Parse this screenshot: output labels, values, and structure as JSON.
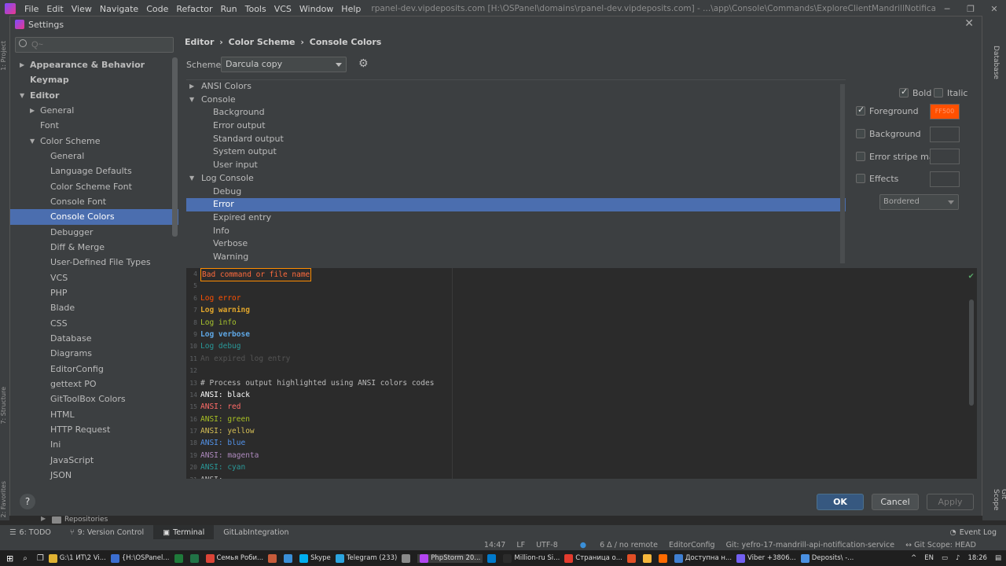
{
  "ide": {
    "menu": [
      "File",
      "Edit",
      "View",
      "Navigate",
      "Code",
      "Refactor",
      "Run",
      "Tools",
      "VCS",
      "Window",
      "Help"
    ],
    "title": "rpanel-dev.vipdeposits.com [H:\\OSPanel\\domains\\rpanel-dev.vipdeposits.com] - ...\\app\\Console\\Commands\\ExploreClientMandrillNotification.php - PhpStorm",
    "left_strip": [
      "1: Project",
      "7: Structure",
      "2: Favorites"
    ],
    "right_strip": [
      "Database",
      "Git Scope"
    ]
  },
  "dialog": {
    "title": "Settings",
    "search_placeholder": "Q~",
    "breadcrumb": [
      "Editor",
      "Color Scheme",
      "Console Colors"
    ],
    "scheme_label": "Scheme:",
    "scheme_value": "Darcula copy",
    "nav": [
      {
        "label": "Appearance & Behavior",
        "level": 0,
        "bold": true,
        "arrow": "▶"
      },
      {
        "label": "Keymap",
        "level": 0,
        "bold": true,
        "arrow": ""
      },
      {
        "label": "Editor",
        "level": 0,
        "bold": true,
        "arrow": "▼"
      },
      {
        "label": "General",
        "level": 1,
        "arrow": "▶"
      },
      {
        "label": "Font",
        "level": 1,
        "arrow": ""
      },
      {
        "label": "Color Scheme",
        "level": 1,
        "arrow": "▼"
      },
      {
        "label": "General",
        "level": 2,
        "arrow": ""
      },
      {
        "label": "Language Defaults",
        "level": 2,
        "arrow": ""
      },
      {
        "label": "Color Scheme Font",
        "level": 2,
        "arrow": ""
      },
      {
        "label": "Console Font",
        "level": 2,
        "arrow": ""
      },
      {
        "label": "Console Colors",
        "level": 2,
        "arrow": "",
        "selected": true
      },
      {
        "label": "Debugger",
        "level": 2,
        "arrow": ""
      },
      {
        "label": "Diff & Merge",
        "level": 2,
        "arrow": ""
      },
      {
        "label": "User-Defined File Types",
        "level": 2,
        "arrow": ""
      },
      {
        "label": "VCS",
        "level": 2,
        "arrow": ""
      },
      {
        "label": "PHP",
        "level": 2,
        "arrow": ""
      },
      {
        "label": "Blade",
        "level": 2,
        "arrow": ""
      },
      {
        "label": "CSS",
        "level": 2,
        "arrow": ""
      },
      {
        "label": "Database",
        "level": 2,
        "arrow": ""
      },
      {
        "label": "Diagrams",
        "level": 2,
        "arrow": ""
      },
      {
        "label": "EditorConfig",
        "level": 2,
        "arrow": ""
      },
      {
        "label": "gettext PO",
        "level": 2,
        "arrow": ""
      },
      {
        "label": "GitToolBox Colors",
        "level": 2,
        "arrow": ""
      },
      {
        "label": "HTML",
        "level": 2,
        "arrow": ""
      },
      {
        "label": "HTTP Request",
        "level": 2,
        "arrow": ""
      },
      {
        "label": "Ini",
        "level": 2,
        "arrow": ""
      },
      {
        "label": "JavaScript",
        "level": 2,
        "arrow": ""
      },
      {
        "label": "JSON",
        "level": 2,
        "arrow": ""
      }
    ],
    "categories": [
      {
        "label": "ANSI Colors",
        "level": 0,
        "arrow": "▶"
      },
      {
        "label": "Console",
        "level": 0,
        "arrow": "▼"
      },
      {
        "label": "Background",
        "level": 1,
        "arrow": ""
      },
      {
        "label": "Error output",
        "level": 1,
        "arrow": ""
      },
      {
        "label": "Standard output",
        "level": 1,
        "arrow": ""
      },
      {
        "label": "System output",
        "level": 1,
        "arrow": ""
      },
      {
        "label": "User input",
        "level": 1,
        "arrow": ""
      },
      {
        "label": "Log Console",
        "level": 0,
        "arrow": "▼"
      },
      {
        "label": "Debug",
        "level": 1,
        "arrow": ""
      },
      {
        "label": "Error",
        "level": 1,
        "arrow": "",
        "selected": true
      },
      {
        "label": "Expired entry",
        "level": 1,
        "arrow": ""
      },
      {
        "label": "Info",
        "level": 1,
        "arrow": ""
      },
      {
        "label": "Verbose",
        "level": 1,
        "arrow": ""
      },
      {
        "label": "Warning",
        "level": 1,
        "arrow": ""
      }
    ],
    "attributes": {
      "bold_label": "Bold",
      "bold_checked": true,
      "italic_label": "Italic",
      "italic_checked": false,
      "foreground_label": "Foreground",
      "foreground_checked": true,
      "foreground_color": "#FF5000",
      "foreground_value": "FF500",
      "background_label": "Background",
      "error_stripe_label": "Error stripe mark",
      "effects_label": "Effects",
      "effect_type": "Bordered"
    },
    "preview": [
      {
        "n": "4",
        "text": "Bad command or file name",
        "color": "#ff6b3d",
        "boxed": true
      },
      {
        "n": "5",
        "text": "",
        "color": "#bbbbbb"
      },
      {
        "n": "6",
        "text": "Log error",
        "color": "#ff5000"
      },
      {
        "n": "7",
        "text": "Log warning",
        "color": "#e0a52b",
        "bold": true
      },
      {
        "n": "8",
        "text": "Log info",
        "color": "#a6c22e"
      },
      {
        "n": "9",
        "text": "Log verbose",
        "color": "#5fa8e6",
        "bold": true
      },
      {
        "n": "10",
        "text": "Log debug",
        "color": "#299999"
      },
      {
        "n": "11",
        "text": "An expired log entry",
        "color": "#555555"
      },
      {
        "n": "12",
        "text": "",
        "color": "#bbbbbb"
      },
      {
        "n": "13",
        "text": "# Process output highlighted using ANSI colors codes",
        "color": "#bbbbbb"
      },
      {
        "n": "14",
        "text": "ANSI: black",
        "color": "#ffffff"
      },
      {
        "n": "15",
        "text": "ANSI: red",
        "color": "#ff6b68"
      },
      {
        "n": "16",
        "text": "ANSI: green",
        "color": "#a8c023"
      },
      {
        "n": "17",
        "text": "ANSI: yellow",
        "color": "#d6bf55"
      },
      {
        "n": "18",
        "text": "ANSI: blue",
        "color": "#5394ec"
      },
      {
        "n": "19",
        "text": "ANSI: magenta",
        "color": "#ae8abe"
      },
      {
        "n": "20",
        "text": "ANSI: cyan",
        "color": "#299999"
      },
      {
        "n": "21",
        "text": "ANSI: ...",
        "color": "#bbbbbb"
      }
    ],
    "buttons": {
      "ok": "OK",
      "cancel": "Cancel",
      "apply": "Apply"
    },
    "help": "?"
  },
  "bottom": {
    "repositories": "Repositories",
    "tabs": [
      "6: TODO",
      "9: Version Control",
      "Terminal",
      "GitLabIntegration"
    ],
    "active_tab": "Terminal",
    "event_log": "Event Log"
  },
  "status": {
    "time": "14:47",
    "line_sep": "LF",
    "encoding": "UTF-8",
    "changes": "6 Δ / no remote",
    "editorconfig": "EditorConfig",
    "branch": "Git: yefro-17-mandrill-api-notification-service",
    "scope": "↔ Git Scope: HEAD"
  },
  "taskbar": {
    "items": [
      {
        "label": "G:\\1 ИТ\\2 Vi...",
        "color": "#e0b232"
      },
      {
        "label": "{H:\\OSPanel...",
        "color": "#3b6ed1"
      },
      {
        "label": "",
        "color": "#1f7a3a"
      },
      {
        "label": "",
        "color": "#217346"
      },
      {
        "label": "Семья Роби...",
        "color": "#db4437"
      },
      {
        "label": "",
        "color": "#c75b3a"
      },
      {
        "label": "",
        "color": "#3a8fd8"
      },
      {
        "label": "Skype",
        "color": "#00aff0"
      },
      {
        "label": "Telegram (233)",
        "color": "#2ca5e0"
      },
      {
        "label": "",
        "color": "#8a8a8a"
      },
      {
        "label": "PhpStorm 20...",
        "color": "#b345f1",
        "active": true
      },
      {
        "label": "",
        "color": "#007acc"
      },
      {
        "label": "Million-ru Si...",
        "color": "#2b2b2b"
      },
      {
        "label": "Страница о...",
        "color": "#e33b2e"
      },
      {
        "label": "",
        "color": "#e34f26"
      },
      {
        "label": "",
        "color": "#f6b73c"
      },
      {
        "label": "",
        "color": "#ff6a00"
      },
      {
        "label": "Доступна н...",
        "color": "#3f7fd1"
      },
      {
        "label": "Viber +3806...",
        "color": "#7360f2"
      },
      {
        "label": "Deposits\\ -...",
        "color": "#4a90e2"
      }
    ],
    "lang": "EN",
    "clock": "18:26"
  }
}
